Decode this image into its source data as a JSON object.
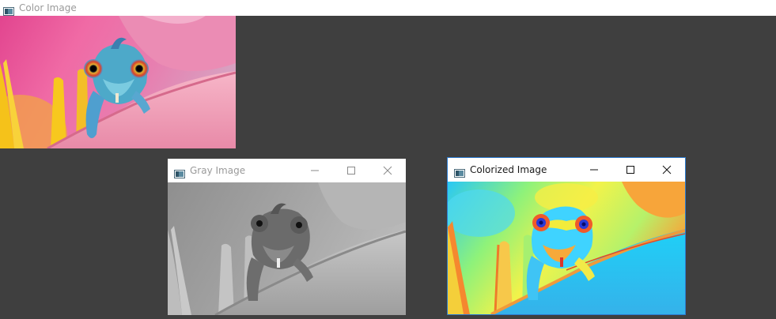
{
  "windows": {
    "color": {
      "title": "Color Image",
      "image": "chameleon-color-photo"
    },
    "gray": {
      "title": "Gray Image",
      "image": "chameleon-grayscale-photo"
    },
    "colorized": {
      "title": "Colorized Image",
      "image": "chameleon-jet-colormap-photo"
    }
  },
  "icons": {
    "window_app": "window-app-icon",
    "minimize": "minimize-icon",
    "maximize": "maximize-icon",
    "close": "close-icon"
  },
  "colors": {
    "desktop": "#3f3f3f",
    "titlebar": "#ffffff",
    "inactive_title": "#9a9a9a",
    "active_title": "#1a1a1a",
    "active_border": "#2b7bd0"
  }
}
